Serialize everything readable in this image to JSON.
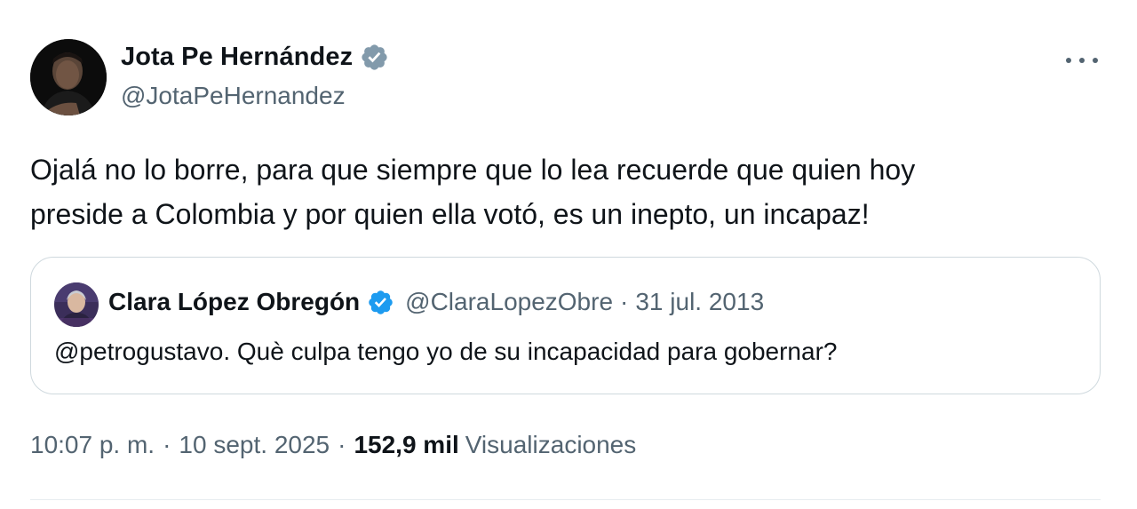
{
  "author": {
    "display_name": "Jota Pe Hernández",
    "handle": "@JotaPeHernandez",
    "verified_icon": "verified-badge-gray"
  },
  "tweet": {
    "text": "Ojalá no lo borre, para que siempre que lo lea recuerde que quien hoy\npreside a Colombia y por quien ella votó, es un inepto, un incapaz!"
  },
  "quoted_tweet": {
    "display_name": "Clara López Obregón",
    "handle": "@ClaraLopezObre",
    "separator": "·",
    "date": "31 jul. 2013",
    "text": "@petrogustavo. Què culpa tengo yo de su incapacidad para gobernar?",
    "verified_icon": "verified-badge-blue"
  },
  "meta": {
    "time": "10:07 p. m.",
    "separator": "·",
    "date": "10 sept. 2025",
    "views_count": "152,9 mil",
    "views_label": "Visualizaciones"
  },
  "colors": {
    "text_primary": "#0f1419",
    "text_secondary": "#536471",
    "border": "#cfd9de",
    "verified_gray": "#829aab",
    "verified_blue": "#1d9bf0"
  }
}
